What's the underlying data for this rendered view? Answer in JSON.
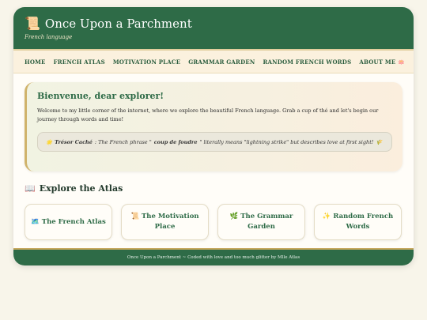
{
  "header": {
    "icon": "scroll-icon",
    "icon_glyph": "📜",
    "title": "Once Upon a Parchment",
    "subtitle": "French language"
  },
  "nav": {
    "items": [
      {
        "label": "HOME"
      },
      {
        "label": "FRENCH ATLAS"
      },
      {
        "label": "MOTIVATION PLACE"
      },
      {
        "label": "GRAMMAR GARDEN"
      },
      {
        "label": "RANDOM FRENCH WORDS"
      },
      {
        "label": "ABOUT ME 🪷"
      }
    ]
  },
  "welcome": {
    "title": "Bienvenue, dear explorer!",
    "text": "Welcome to my little corner of the internet, where we explore the beautiful French language. Grab a cup of thé and let's begin our journey through words and time!",
    "tip": {
      "star": "🌟",
      "label": "Trésor Caché",
      "sep": " : The French phrase \"",
      "phrase": "coup de foudre",
      "rest": "\" literally means \"lightning strike\" but describes love at first sight!",
      "end_icon": "🌾"
    }
  },
  "atlas": {
    "icon_glyph": "📖",
    "title": "Explore the Atlas",
    "tiles": [
      {
        "label": "🗺️ The French Atlas"
      },
      {
        "label": "📜 The Motivation Place"
      },
      {
        "label": "🌿 The Grammar Garden"
      },
      {
        "label": "✨ Random French Words"
      }
    ]
  },
  "footer": {
    "text": "Once Upon a Parchment ~ Coded with love and too much glitter by Mlle Atlas"
  },
  "colors": {
    "accent": "#2e6b47",
    "gold": "#c7a960",
    "background": "#f8f5ea"
  }
}
